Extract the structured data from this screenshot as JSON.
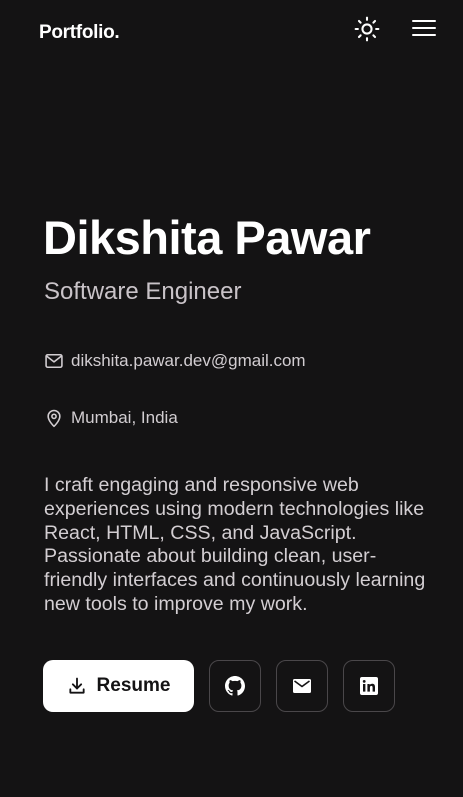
{
  "header": {
    "logo": "Portfolio.",
    "theme_toggle_icon": "sun-icon",
    "menu_icon": "hamburger-menu-icon"
  },
  "hero": {
    "name": "Dikshita Pawar",
    "role": "Software Engineer",
    "email": "dikshita.pawar.dev@gmail.com",
    "email_icon": "mail-icon",
    "location": "Mumbai, India",
    "location_icon": "map-pin-icon",
    "bio": "I craft engaging and responsive web experiences using modern technologies like React, HTML, CSS, and JavaScript. Passionate about building clean, user-friendly interfaces and continuously learning new tools to improve my work."
  },
  "actions": {
    "resume_label": "Resume",
    "resume_icon": "download-icon",
    "social": [
      {
        "name": "github",
        "icon": "github-icon"
      },
      {
        "name": "email",
        "icon": "envelope-icon"
      },
      {
        "name": "linkedin",
        "icon": "linkedin-icon"
      }
    ]
  },
  "colors": {
    "background": "#141314",
    "text": "#ffffff",
    "muted_text": "#d3ced2",
    "button_bg": "#ffffff",
    "button_border": "#4a474a"
  }
}
